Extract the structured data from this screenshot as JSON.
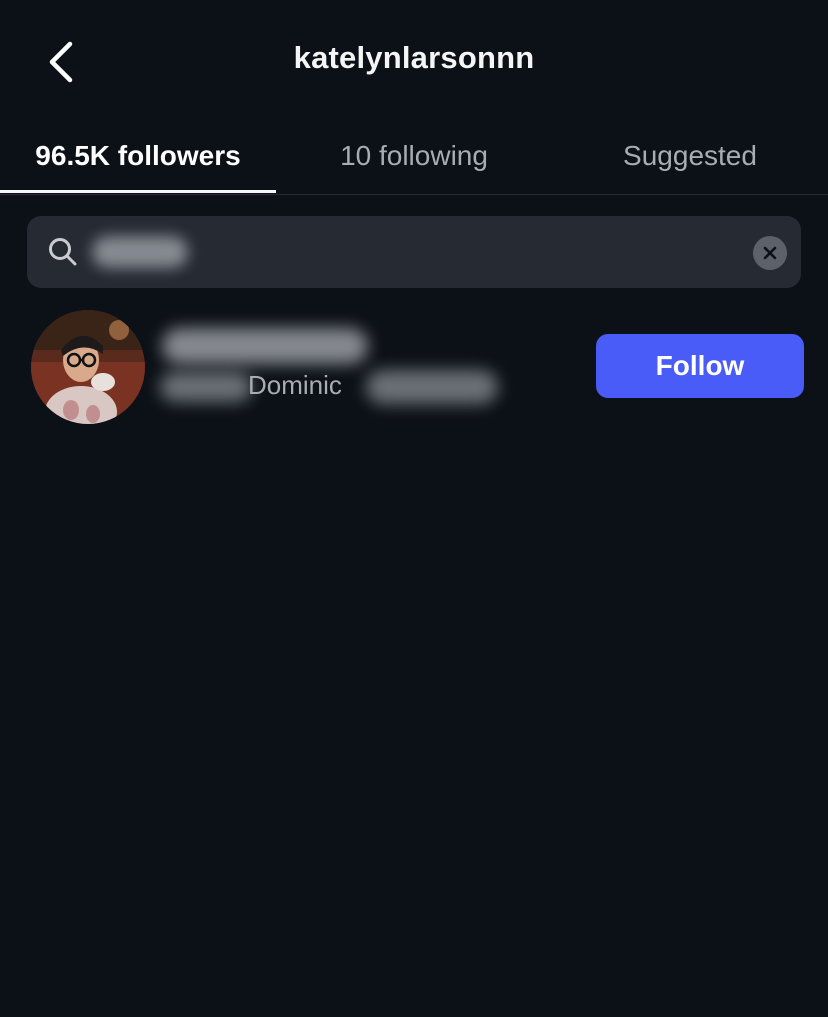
{
  "header": {
    "title": "katelynlarsonnn",
    "back_icon": "chevron-left-icon"
  },
  "tabs": [
    {
      "label": "96.5K followers",
      "active": true
    },
    {
      "label": "10 following",
      "active": false
    },
    {
      "label": "Suggested",
      "active": false
    }
  ],
  "search": {
    "value": "",
    "placeholder": "",
    "icon": "search-icon",
    "clear_icon": "clear-icon"
  },
  "results": [
    {
      "display_name": "Dominic",
      "follow_label": "Follow"
    }
  ],
  "colors": {
    "background": "#0c1017",
    "search_bg": "#252a33",
    "accent": "#4a5cf7",
    "muted_text": "#a8acb3"
  }
}
